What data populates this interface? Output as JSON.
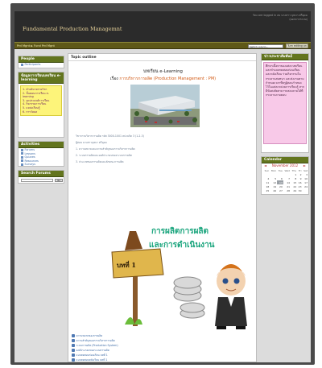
{
  "header": {
    "site_title": "Fundamental Production Managemnt",
    "login_line1": "You are logged in as นางสาว บุษบา ศรีอุดม",
    "login_line2": "(ออกจากระบบ)"
  },
  "navbar": {
    "breadcrumb": "Prd Mgnt  ►  Fund Prd Mgnt",
    "jump_value": "Switch role to...",
    "turn_edit_label": "Turn editing on"
  },
  "left": {
    "people": {
      "title": "People",
      "items": [
        "Participants"
      ]
    },
    "course_info": {
      "title": "ข้อมูลการเรียนบทเรียน e-learning",
      "items": [
        "1. คำอธิบายรายวิชา",
        "2. ขั้นตอนการเรียน e-learning",
        "3. จุดประสงค์การเรียน",
        "4. กิจกรรมการเรียน",
        "5. แหล่งเรียนรู้",
        "6. การวัดผล"
      ]
    },
    "activities": {
      "title": "Activities",
      "items": [
        "Forums",
        "Lessons",
        "Quizzes",
        "Resources",
        "Surveys"
      ]
    },
    "search": {
      "title": "Search Forums",
      "button": "Go"
    }
  },
  "main": {
    "heading": "Topic outline",
    "course_title": "บทเรียน e-Learning",
    "course_sub_prefix": "เรื่อง ",
    "course_sub_link": "การบริหารการผลิต (Production Management : PM)",
    "intro_lines": [
      "วิชาการบริหารการผลิต รหัส 3000-1001 หน่วยกิต 3 (1-2-3)",
      "ผู้สอน นางสาวบุษบา ศรีอุดม",
      "1. ความหมายและความสำคัญของการบริหารการผลิต",
      "2. ระบบการผลิตและองค์ประกอบของระบบการผลิต",
      "3. ประเภทของการผลิตและลักษณะการผลิต"
    ],
    "art_title": "การผลิตการผลิต",
    "art_sub": "และการดำเนินงาน",
    "sign_text": "บทที่ 1",
    "links": [
      "ความหมายของการผลิต",
      "ความสำคัญของการบริหารการผลิต",
      "ระบบการผลิต (Production System)",
      "องค์ประกอบของระบบการผลิต",
      "แบบทดสอบก่อนเรียน บทที่ 1",
      "แบบทดสอบหลังเรียน บทที่ 1",
      "ใบงานที่ 1",
      "ใบงานที่ 2",
      "ใบความรู้ที่ 1",
      "การจัดการการผลิต",
      "ระบบสารสนเทศ",
      "ประเมินผลบทเรียน",
      "สรุปเนื้อหา"
    ]
  },
  "right": {
    "news": {
      "title": "ข่าวประชาสัมพันธ์",
      "text": "ศึกษาเนื้อหาของแต่ละบทเรียนและทำแบบทดสอบก่อนเรียนและหลังเรียน ร่วมกิจกรรมในกระดานสนทนา และส่งงานตามกำหนดเวลาที่ครูผู้สอนกำหนดไว้ในแต่ละหน่วยการเรียนรู้ หากมีข้อสงสัยสามารถสอบถามได้ที่กระดานถามตอบ"
    },
    "calendar": {
      "title": "Calendar",
      "month": "November 2012",
      "prev": "◄",
      "next": "►",
      "days": [
        "Sun",
        "Mon",
        "Tue",
        "Wed",
        "Thu",
        "Fri",
        "Sat"
      ],
      "weeks": [
        [
          "",
          "",
          "",
          "",
          "1",
          "2",
          "3"
        ],
        [
          "4",
          "5",
          "6",
          "7",
          "8",
          "9",
          "10"
        ],
        [
          "11",
          "12",
          "13",
          "14",
          "15",
          "16",
          "17"
        ],
        [
          "18",
          "19",
          "20",
          "21",
          "22",
          "23",
          "24"
        ],
        [
          "25",
          "26",
          "27",
          "28",
          "29",
          "30",
          ""
        ]
      ],
      "today": "13"
    }
  }
}
